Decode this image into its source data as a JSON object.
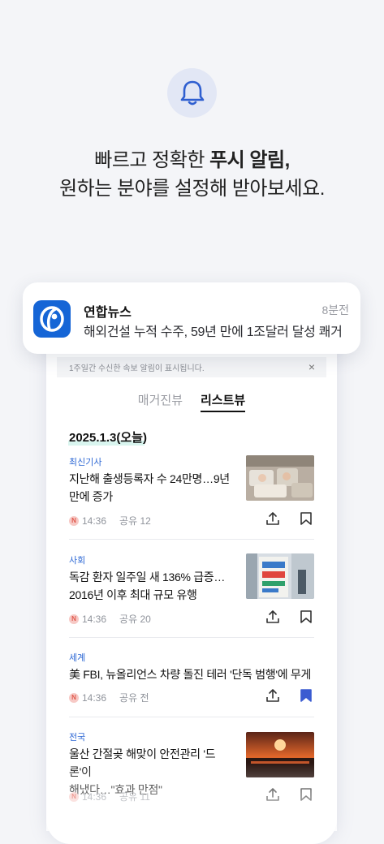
{
  "headline": {
    "line1_normal": "빠르고 정확한 ",
    "line1_bold": "푸시 알림,",
    "line2": "원하는 분야를 설정해 받아보세요."
  },
  "notification": {
    "app_name": "연합뉴스",
    "time": "8분전",
    "message": "해외건설 누적 수주, 59년 만에 1조달러 달성 쾌거"
  },
  "banner": {
    "text": "1주일간 수신한 속보 알림이 표시됩니다.",
    "close": "×"
  },
  "tabs": [
    {
      "label": "매거진뷰",
      "active": false
    },
    {
      "label": "리스트뷰",
      "active": true
    }
  ],
  "date_label": "2025.1.3(오늘)",
  "articles": [
    {
      "category": "최신기사",
      "title_line1": "지난해 출생등록자 수 24만명…9년",
      "title_line2": "만에 증가",
      "time": "14:36",
      "share": "공유 12",
      "bookmarked": false
    },
    {
      "category": "사회",
      "title_line1": "독감 환자 일주일 새 136% 급증…",
      "title_line2": "2016년 이후 최대 규모 유행",
      "time": "14:36",
      "share": "공유 20",
      "bookmarked": false
    },
    {
      "category": "세계",
      "title_line1": "美 FBI, 뉴올리언스 차량 돌진 테러 '단독 범행'에 무게",
      "title_line2": "",
      "time": "14:36",
      "share": "공유 전",
      "bookmarked": true
    },
    {
      "category": "전국",
      "title_line1": "울산 간절곶 해맞이 안전관리 '드론'이",
      "title_line2": "해냈다…\"효과 만점\"",
      "time": "14:36",
      "share": "공유 11",
      "bookmarked": false
    }
  ],
  "colors": {
    "accent_blue": "#2c67d4",
    "bookmark_active": "#3b5bd1",
    "app_icon": "#1565d6"
  },
  "icons": {
    "bell": "bell-icon",
    "share": "share-icon",
    "bookmark": "bookmark-icon",
    "app": "yonhap-logo-icon"
  }
}
